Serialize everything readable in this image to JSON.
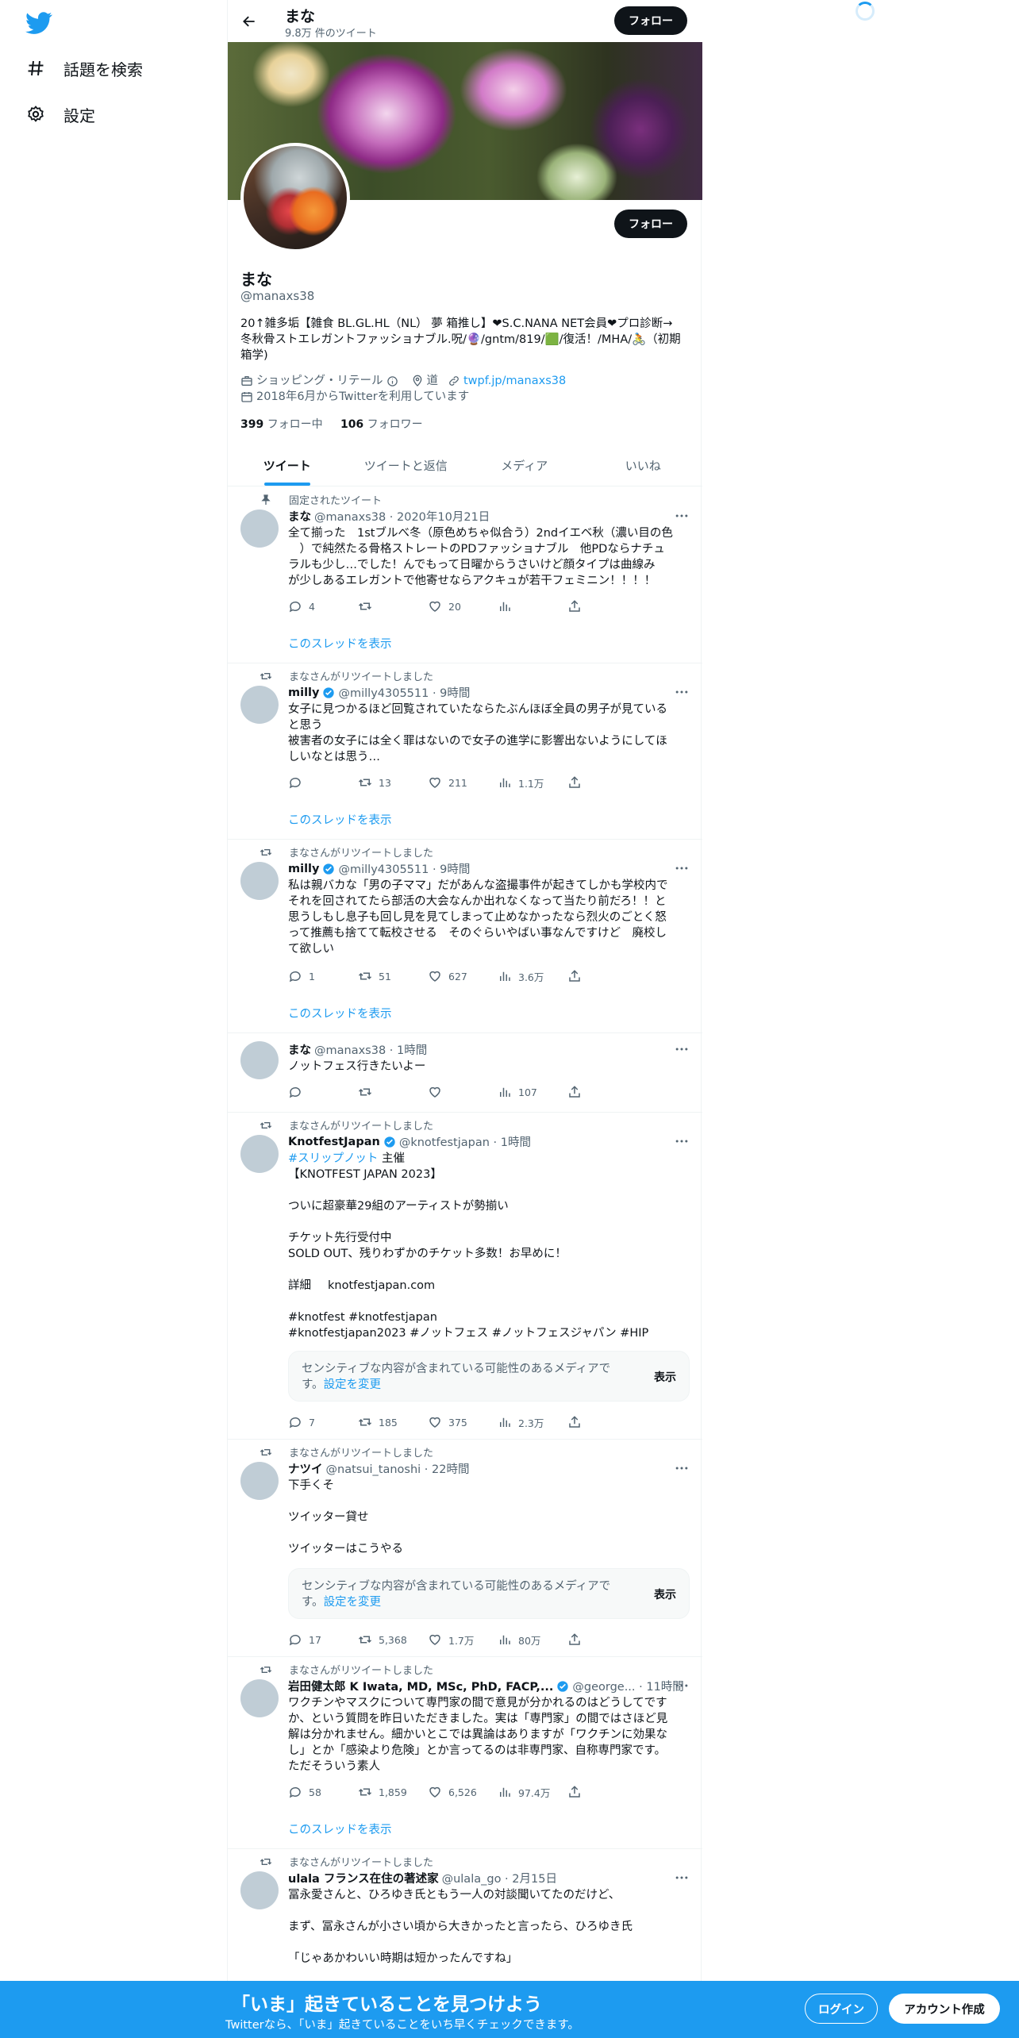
{
  "nav": {
    "explore_label": "話題を検索",
    "settings_label": "設定"
  },
  "header": {
    "name": "まな",
    "tweet_count": "9.8万 件のツイート",
    "follow_label": "フォロー"
  },
  "profile": {
    "name": "まな",
    "handle": "@manaxs38",
    "follow_label": "フォロー",
    "bio_line1": "20↑雑多垢【雑食 BL.GL.HL（NL） 夢 箱推し】❤S.C.NANA NET会員❤プロ診断→",
    "bio_line2": "冬秋骨ストエレガントファッショナブル.呪/🔮/gntm/819/🟩/復活！/MHA/🚴（初期",
    "bio_line3": "箱学)",
    "category": "ショッピング・リテール",
    "location": "道",
    "website": "twpf.jp/manaxs38",
    "joined": "2018年6月からTwitterを利用しています",
    "following_count": "399",
    "following_label": "フォロー中",
    "followers_count": "106",
    "followers_label": "フォロワー"
  },
  "tabs": [
    "ツイート",
    "ツイートと返信",
    "メディア",
    "いいね"
  ],
  "show_thread_label": "このスレッドを表示",
  "sensitive_text": "センシティブな内容が含まれている可能性のあるメディアです。",
  "sensitive_link": "設定を変更",
  "sensitive_show": "表示",
  "tweets": [
    {
      "context": "固定されたツイート",
      "name": "まな",
      "handle": "@manaxs38 · 2020年10月21日",
      "body": "全て揃った　1stブルべ冬（原色めちゃ似合う）2ndイエベ秋（濃い目の色\n　）で純然たる骨格ストレートのPDファッショナブル　他PDならナチュ\nラルも少し…でした！んでもって日曜からうさいけど顔タイプは曲線み\nが少しあるエレガントで他寄せならアクキュが若干フェミニン！！！！",
      "reply": "4",
      "retweet": "",
      "like": "20",
      "views": ""
    },
    {
      "context": "まなさんがリツイートしました",
      "name": "milly",
      "handle": "@milly4305511 · 9時間",
      "body": "女子に見つかるほど回覧されていたならたぶんほぼ全員の男子が見ている\nと思う\n被害者の女子には全く罪はないので女子の進学に影響出ないようにしてほ\nしいなとは思う…",
      "reply": "",
      "retweet": "13",
      "like": "211",
      "views": "1.1万"
    },
    {
      "context": "まなさんがリツイートしました",
      "name": "milly",
      "handle": "@milly4305511 · 9時間",
      "body": "私は親バカな「男の子ママ」だがあんな盗撮事件が起きてしかも学校内で\nそれを回されてたら部活の大会なんか出れなくなって当たり前だろ！！と\n思うしもし息子も回し見を見てしまって止めなかったなら烈火のごとく怒\nって推薦も捨てて転校させる　そのぐらいやばい事なんですけど　廃校し\nて欲しい",
      "reply": "1",
      "retweet": "51",
      "like": "627",
      "views": "3.6万"
    },
    {
      "context": "",
      "name": "まな",
      "handle": "@manaxs38 · 1時間",
      "body": "ノットフェス行きたいよー",
      "reply": "",
      "retweet": "",
      "like": "",
      "views": "107"
    },
    {
      "context": "まなさんがリツイートしました",
      "name": "KnotfestJapan",
      "handle": "@knotfestjapan · 1時間",
      "body_hashtag": "#スリップノット",
      "body_after_hashtag": " 主催",
      "body": "【KNOTFEST JAPAN 2023】\n\nついに超豪華29組のアーティストが勢揃い\n\nチケット先行受付中\nSOLD OUT、残りわずかのチケット多数！お早めに！\n\n詳細",
      "link": "knotfestjapan.com",
      "tags1": "#knotfest #knotfestjapan",
      "tags2": "#knotfestjapan2023 #ノットフェス #ノットフェスジャパン #HIP",
      "reply": "7",
      "retweet": "185",
      "like": "375",
      "views": "2.3万"
    },
    {
      "context": "まなさんがリツイートしました",
      "name": "ナツイ",
      "handle": "@natsui_tanoshi · 22時間",
      "body": "下手くそ\n\nツイッター貸せ\n\nツイッターはこうやる",
      "reply": "17",
      "retweet": "5,368",
      "like": "1.7万",
      "views": "80万"
    },
    {
      "context": "まなさんがリツイートしました",
      "name": "岩田健太郎 K Iwata, MD, MSc, PhD, FACP,...",
      "handle": "@george... · 11時間",
      "body": "ワクチンやマスクについて専門家の間で意見が分かれるのはどうしてです\nか、という質問を昨日いただきました。実は「専門家」の間ではさほど見\n解は分かれません。細かいとこでは異論はありますが「ワクチンに効果な\nし」とか「感染より危険」とか言ってるのは非専門家、自称専門家です。\nただそういう素人",
      "reply": "58",
      "retweet": "1,859",
      "like": "6,526",
      "views": "97.4万"
    },
    {
      "context": "まなさんがリツイートしました",
      "name": "ulala フランス在住の著述家",
      "handle": "@ulala_go · 2月15日",
      "body": "冨永愛さんと、ひろゆき氏ともう一人の対談聞いてたのだけど、\n\nまず、冨永さんが小さい頃から大きかったと言ったら、ひろゆき氏\n\n「じゃあかわいい時期は短かったんですね」"
    }
  ],
  "bottom": {
    "title": "「いま」起きていることを見つけよう",
    "subtitle": "Twitterなら、「いま」起きていることをいち早くチェックできます。",
    "login": "ログイン",
    "signup": "アカウント作成"
  },
  "colors": {
    "accent": "#1d9bf0",
    "text": "#0f1419",
    "muted": "#536471"
  }
}
